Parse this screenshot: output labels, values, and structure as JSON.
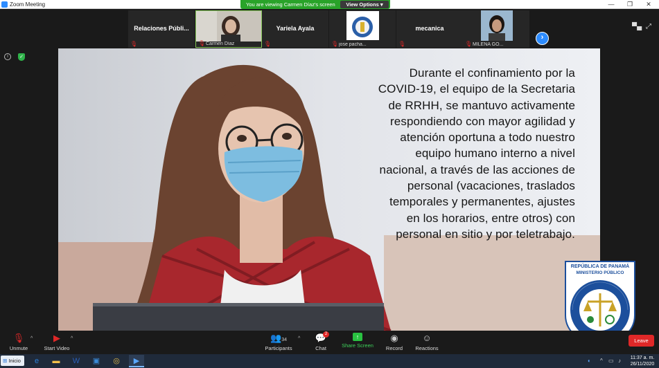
{
  "window": {
    "title": "Zoom Meeting",
    "minimize": "—",
    "maximize": "❐",
    "close": "✕"
  },
  "banner": {
    "text": "You are viewing Carmen Díaz's screen",
    "view_options": "View Options ▾"
  },
  "participants_strip": [
    {
      "name": "Relaciones  Públi...",
      "kind": "name-only"
    },
    {
      "name": "Carmen Díaz",
      "kind": "video"
    },
    {
      "name": "Yariela Ayala",
      "kind": "name-only"
    },
    {
      "name": "jose pacha...",
      "kind": "logo"
    },
    {
      "name": "mecanica",
      "kind": "name-only"
    },
    {
      "name": "MILENA GO...",
      "kind": "video"
    }
  ],
  "slide": {
    "lines": [
      "Durante el confinamiento por la",
      "COVID-19, el equipo de la Secretaria",
      "de RRHH, se mantuvo  activamente",
      "respondiendo con mayor agilidad y",
      "atención oportuna a todo nuestro",
      "equipo humano interno a nivel",
      "nacional, a través de las acciones de",
      "personal (vacaciones, traslados",
      "temporales y permanentes, ajustes",
      "en los horarios, entre otros) con",
      "personal en sitio y por teletrabajo."
    ],
    "logo": {
      "line1": "REPÚBLICA DE PANAMÁ",
      "line2": "MINISTERIO PÚBLICO",
      "arc": "INSTITUTO DE MEDICINA LEGAL Y CIENCIAS FORENSES"
    }
  },
  "toolbar": {
    "unmute": "Unmute",
    "start_video": "Start Video",
    "participants": "Participants",
    "participants_count": "34",
    "chat": "Chat",
    "chat_badge": "2",
    "share_screen": "Share Screen",
    "record": "Record",
    "reactions": "Reactions",
    "leave": "Leave"
  },
  "taskbar": {
    "start": "Inicio",
    "time": "11:37 a. m.",
    "date": "26/11/2020"
  },
  "colors": {
    "zoom_blue": "#2d8cff",
    "banner_green": "#29a329",
    "leave_red": "#e02828"
  }
}
